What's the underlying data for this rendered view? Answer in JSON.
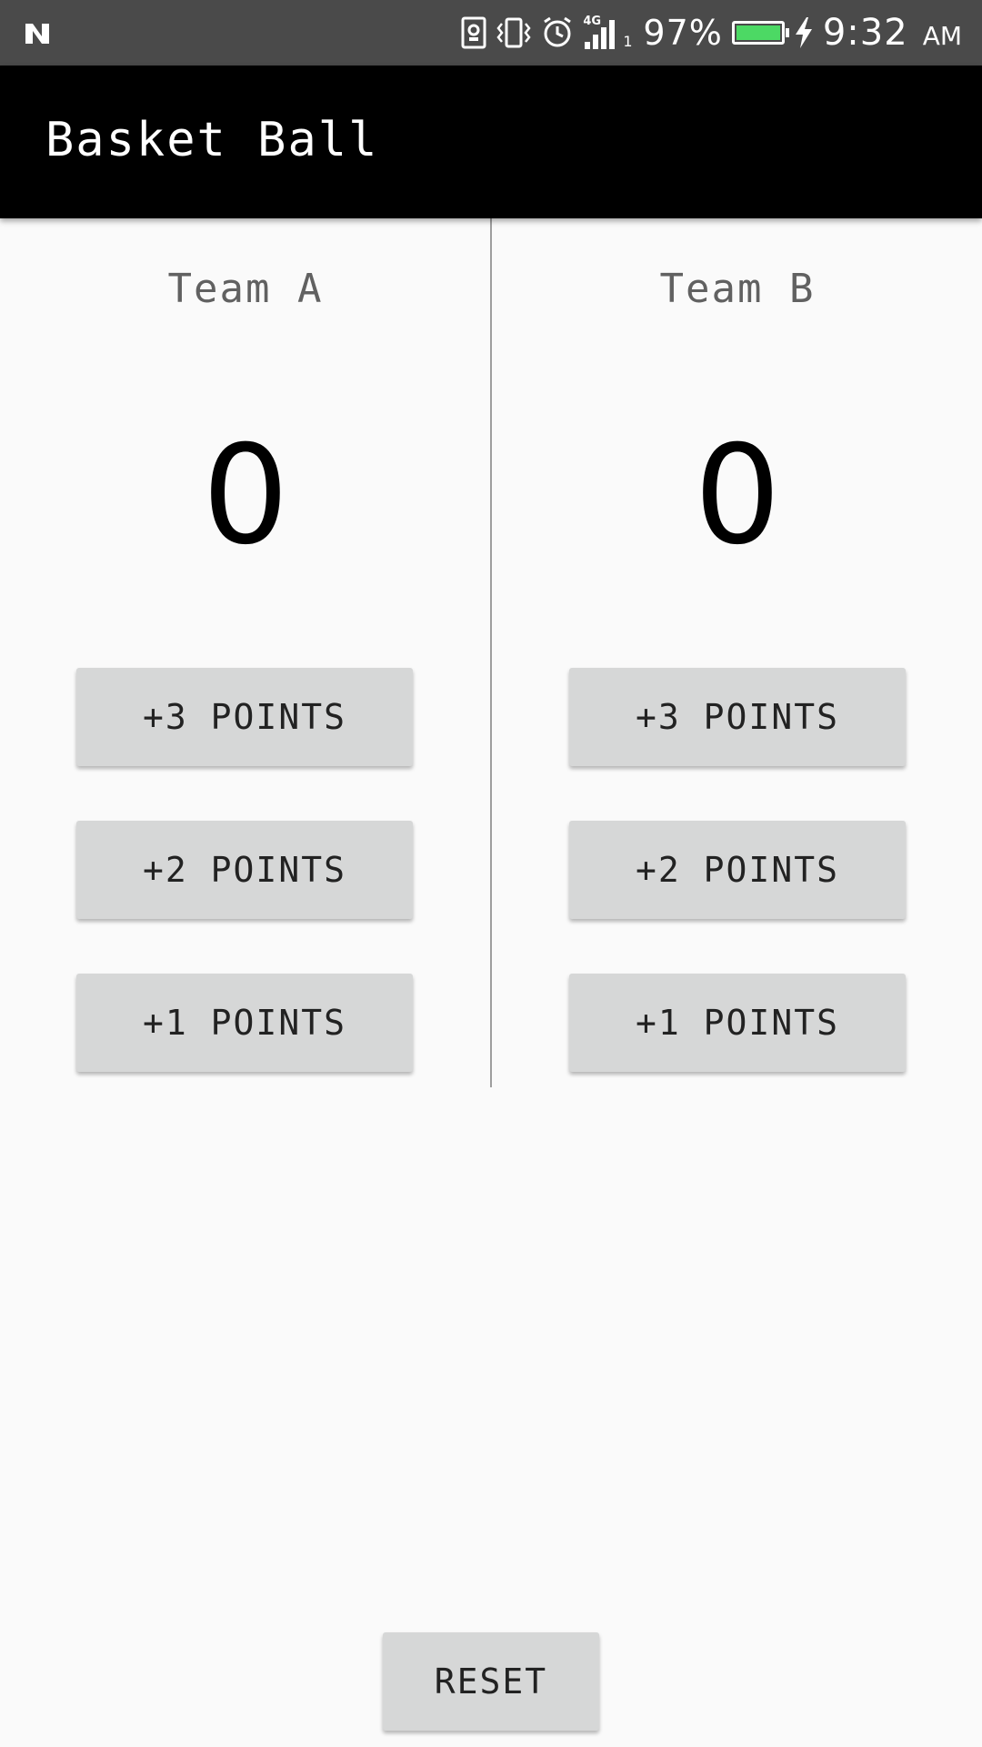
{
  "status_bar": {
    "network_type": "4G",
    "sim_slot": "1",
    "battery_percent": "97%",
    "time": "9:32",
    "ampm": "AM",
    "battery_color": "#4cd964",
    "icons": [
      "n-logo-icon",
      "sim-card-icon",
      "vibrate-icon",
      "alarm-icon",
      "signal-icon",
      "battery-icon",
      "charging-bolt-icon"
    ]
  },
  "app_bar": {
    "title": "Basket Ball",
    "background": "#000000"
  },
  "teams": [
    {
      "name": "Team A",
      "score": "0",
      "buttons": [
        "+3 POINTS",
        "+2 POINTS",
        "+1 POINTS"
      ]
    },
    {
      "name": "Team B",
      "score": "0",
      "buttons": [
        "+3 POINTS",
        "+2 POINTS",
        "+1 POINTS"
      ]
    }
  ],
  "reset_label": "RESET"
}
